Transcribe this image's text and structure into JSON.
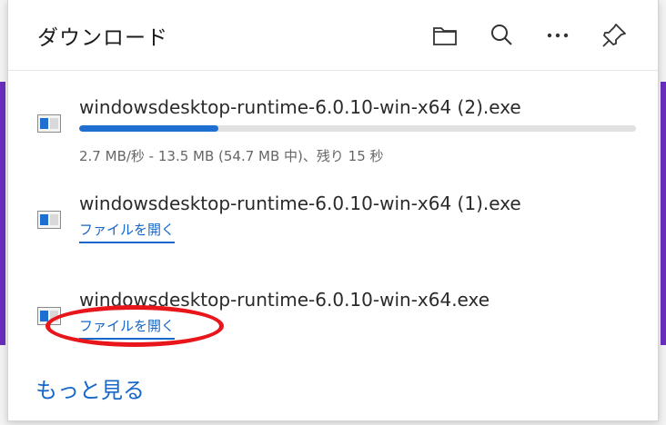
{
  "header": {
    "title": "ダウンロード",
    "icons": [
      "folder-icon",
      "search-icon",
      "more-options-icon",
      "pin-icon"
    ]
  },
  "downloads": [
    {
      "filename": "windowsdesktop-runtime-6.0.10-win-x64 (2).exe",
      "progress": 0.25,
      "status": "2.7 MB/秒 - 13.5 MB (54.7 MB 中)、残り 15 秒"
    },
    {
      "filename": "windowsdesktop-runtime-6.0.10-win-x64 (1).exe",
      "action": "ファイルを開く"
    },
    {
      "filename": "windowsdesktop-runtime-6.0.10-win-x64.exe",
      "action": "ファイルを開く"
    }
  ],
  "footer": {
    "more_label": "もっと見る"
  },
  "colors": {
    "accent": "#1667c9",
    "progress": "#1f6fd1",
    "annotation": "#e8161a"
  }
}
